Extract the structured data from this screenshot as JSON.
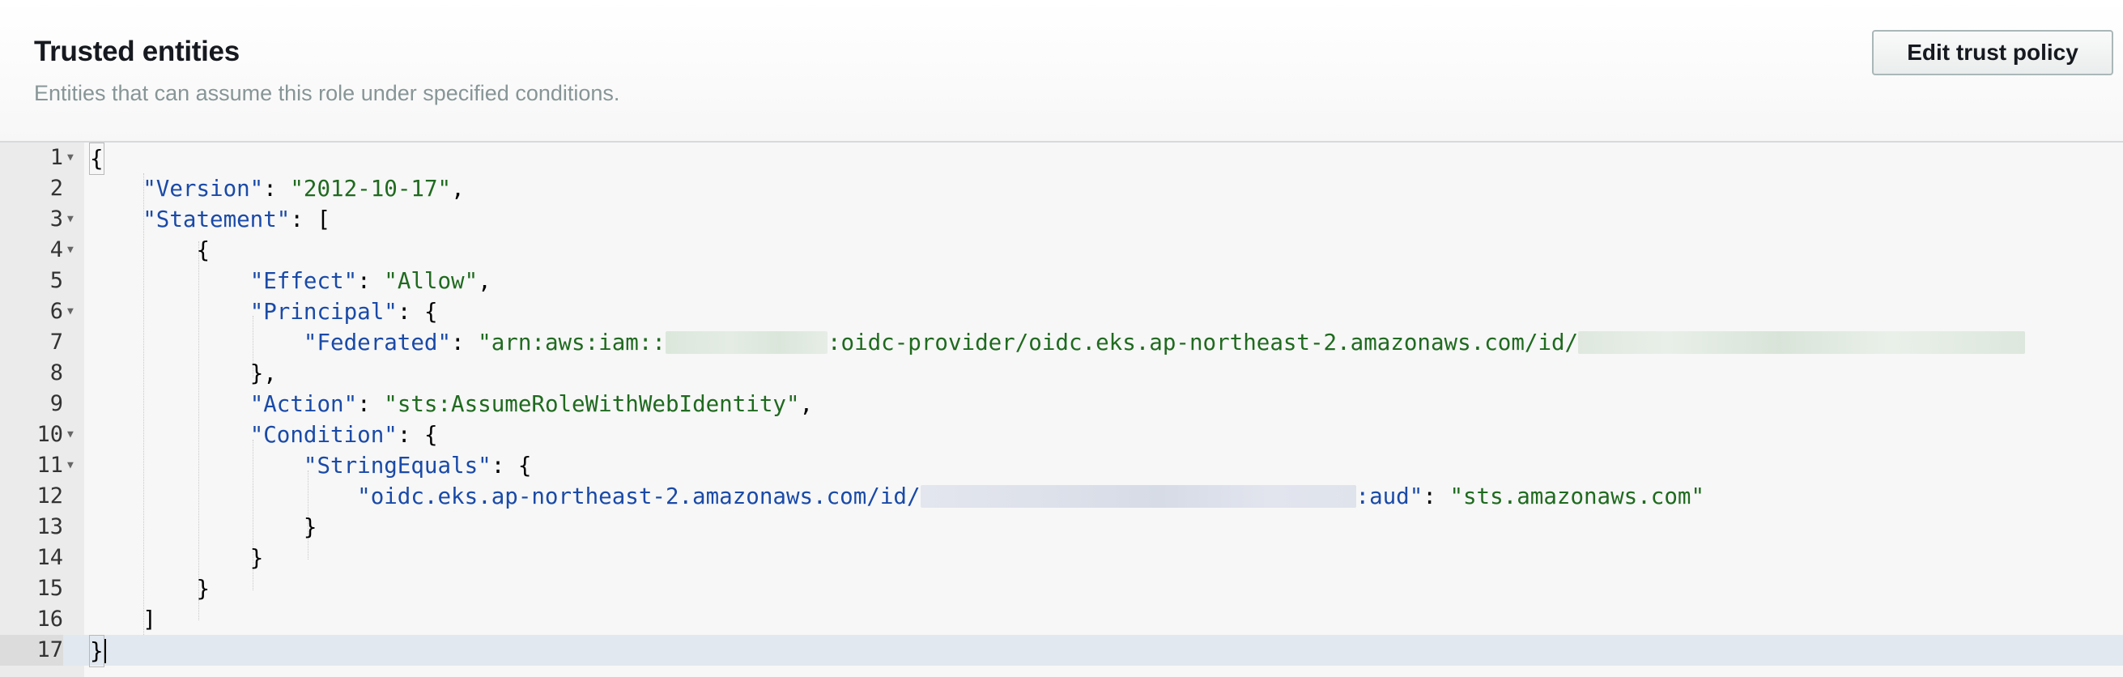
{
  "panel": {
    "title": "Trusted entities",
    "subtitle": "Entities that can assume this role under specified conditions.",
    "edit_button_label": "Edit trust policy"
  },
  "editor": {
    "line_numbers": [
      "1",
      "2",
      "3",
      "4",
      "5",
      "6",
      "7",
      "8",
      "9",
      "10",
      "11",
      "12",
      "13",
      "14",
      "15",
      "16",
      "17"
    ],
    "foldable_lines": [
      1,
      3,
      4,
      6,
      10,
      11
    ],
    "active_line": 17,
    "tokens": {
      "l1_open": "{",
      "version_key": "\"Version\"",
      "version_value": "\"2012-10-17\"",
      "statement_key": "\"Statement\"",
      "statement_open": "[",
      "stmt_open": "{",
      "effect_key": "\"Effect\"",
      "effect_value": "\"Allow\"",
      "principal_key": "\"Principal\"",
      "principal_open": "{",
      "federated_key": "\"Federated\"",
      "federated_value_prefix": "\"arn:aws:iam::",
      "federated_value_middle": ":oidc-provider/oidc.eks.ap-northeast-2.amazonaws.com/id/",
      "principal_close": "},",
      "action_key": "\"Action\"",
      "action_value": "\"sts:AssumeRoleWithWebIdentity\"",
      "condition_key": "\"Condition\"",
      "condition_open": "{",
      "stringequals_key": "\"StringEquals\"",
      "stringequals_open": "{",
      "aud_key_prefix": "\"oidc.eks.ap-northeast-2.amazonaws.com/id/",
      "aud_key_suffix": ":aud\"",
      "aud_value": "\"sts.amazonaws.com\"",
      "stringequals_close": "}",
      "condition_close": "}",
      "stmt_close": "}",
      "statement_close": "]",
      "root_close": "}"
    }
  },
  "colors": {
    "json_key": "#1a4aa8",
    "json_string": "#1f6a1f",
    "active_line_bg": "#e2e8ef"
  }
}
